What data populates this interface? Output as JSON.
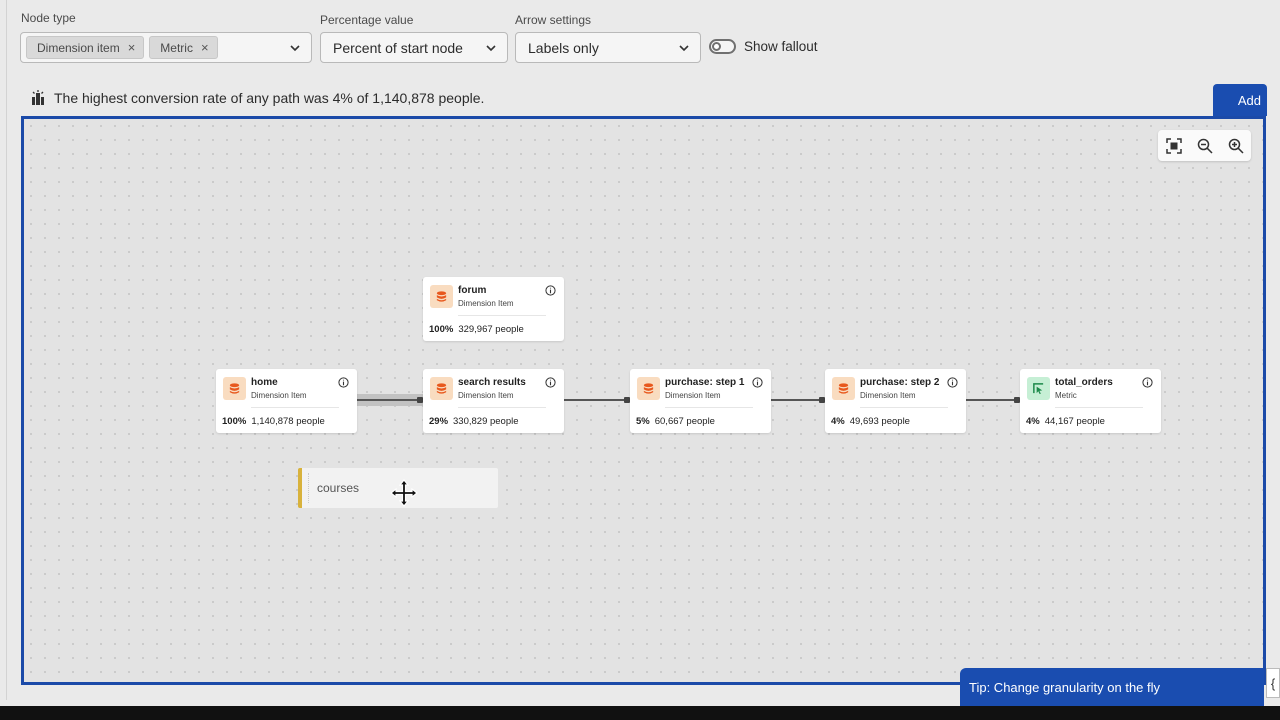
{
  "controls": {
    "node_type": {
      "label": "Node type",
      "tags": [
        {
          "label": "Dimension item"
        },
        {
          "label": "Metric"
        }
      ],
      "tag_remove_glyph": "×"
    },
    "percentage_value": {
      "label": "Percentage value",
      "selected": "Percent of start node"
    },
    "arrow_settings": {
      "label": "Arrow settings",
      "selected": "Labels only"
    },
    "show_fallout": {
      "label": "Show fallout",
      "enabled": false
    }
  },
  "banner": {
    "icon": "insight-icon",
    "text": "The highest conversion rate of any path was 4% of 1,140,878 people."
  },
  "add_button": {
    "label": "Add"
  },
  "zoom_controls": {
    "icons": [
      "fit-to-screen-icon",
      "zoom-out-icon",
      "zoom-in-icon"
    ]
  },
  "nodes": [
    {
      "id": "forum",
      "title": "forum",
      "subtitle": "Dimension Item",
      "percent": "100%",
      "people": "329,967 people",
      "icon": "dimension-icon"
    },
    {
      "id": "home",
      "title": "home",
      "subtitle": "Dimension Item",
      "percent": "100%",
      "people": "1,140,878 people",
      "icon": "dimension-icon"
    },
    {
      "id": "search-results",
      "title": "search results",
      "subtitle": "Dimension Item",
      "percent": "29%",
      "people": "330,829 people",
      "icon": "dimension-icon"
    },
    {
      "id": "purchase-step-1",
      "title": "purchase: step 1",
      "subtitle": "Dimension Item",
      "percent": "5%",
      "people": "60,667 people",
      "icon": "dimension-icon"
    },
    {
      "id": "purchase-step-2",
      "title": "purchase: step 2",
      "subtitle": "Dimension Item",
      "percent": "4%",
      "people": "49,693 people",
      "icon": "dimension-icon"
    },
    {
      "id": "total-orders",
      "title": "total_orders",
      "subtitle": "Metric",
      "percent": "4%",
      "people": "44,167 people",
      "icon": "metric-icon"
    }
  ],
  "dragged_item": {
    "label": "courses"
  },
  "tip": {
    "text": "Tip: Change granularity on the fly",
    "edge_glyph": "{"
  },
  "colors": {
    "accent": "#1a4db0",
    "dimension_icon_bg": "#f9dcc0",
    "metric_icon_bg": "#c6efd5",
    "drag_accent": "#d8b23c"
  }
}
